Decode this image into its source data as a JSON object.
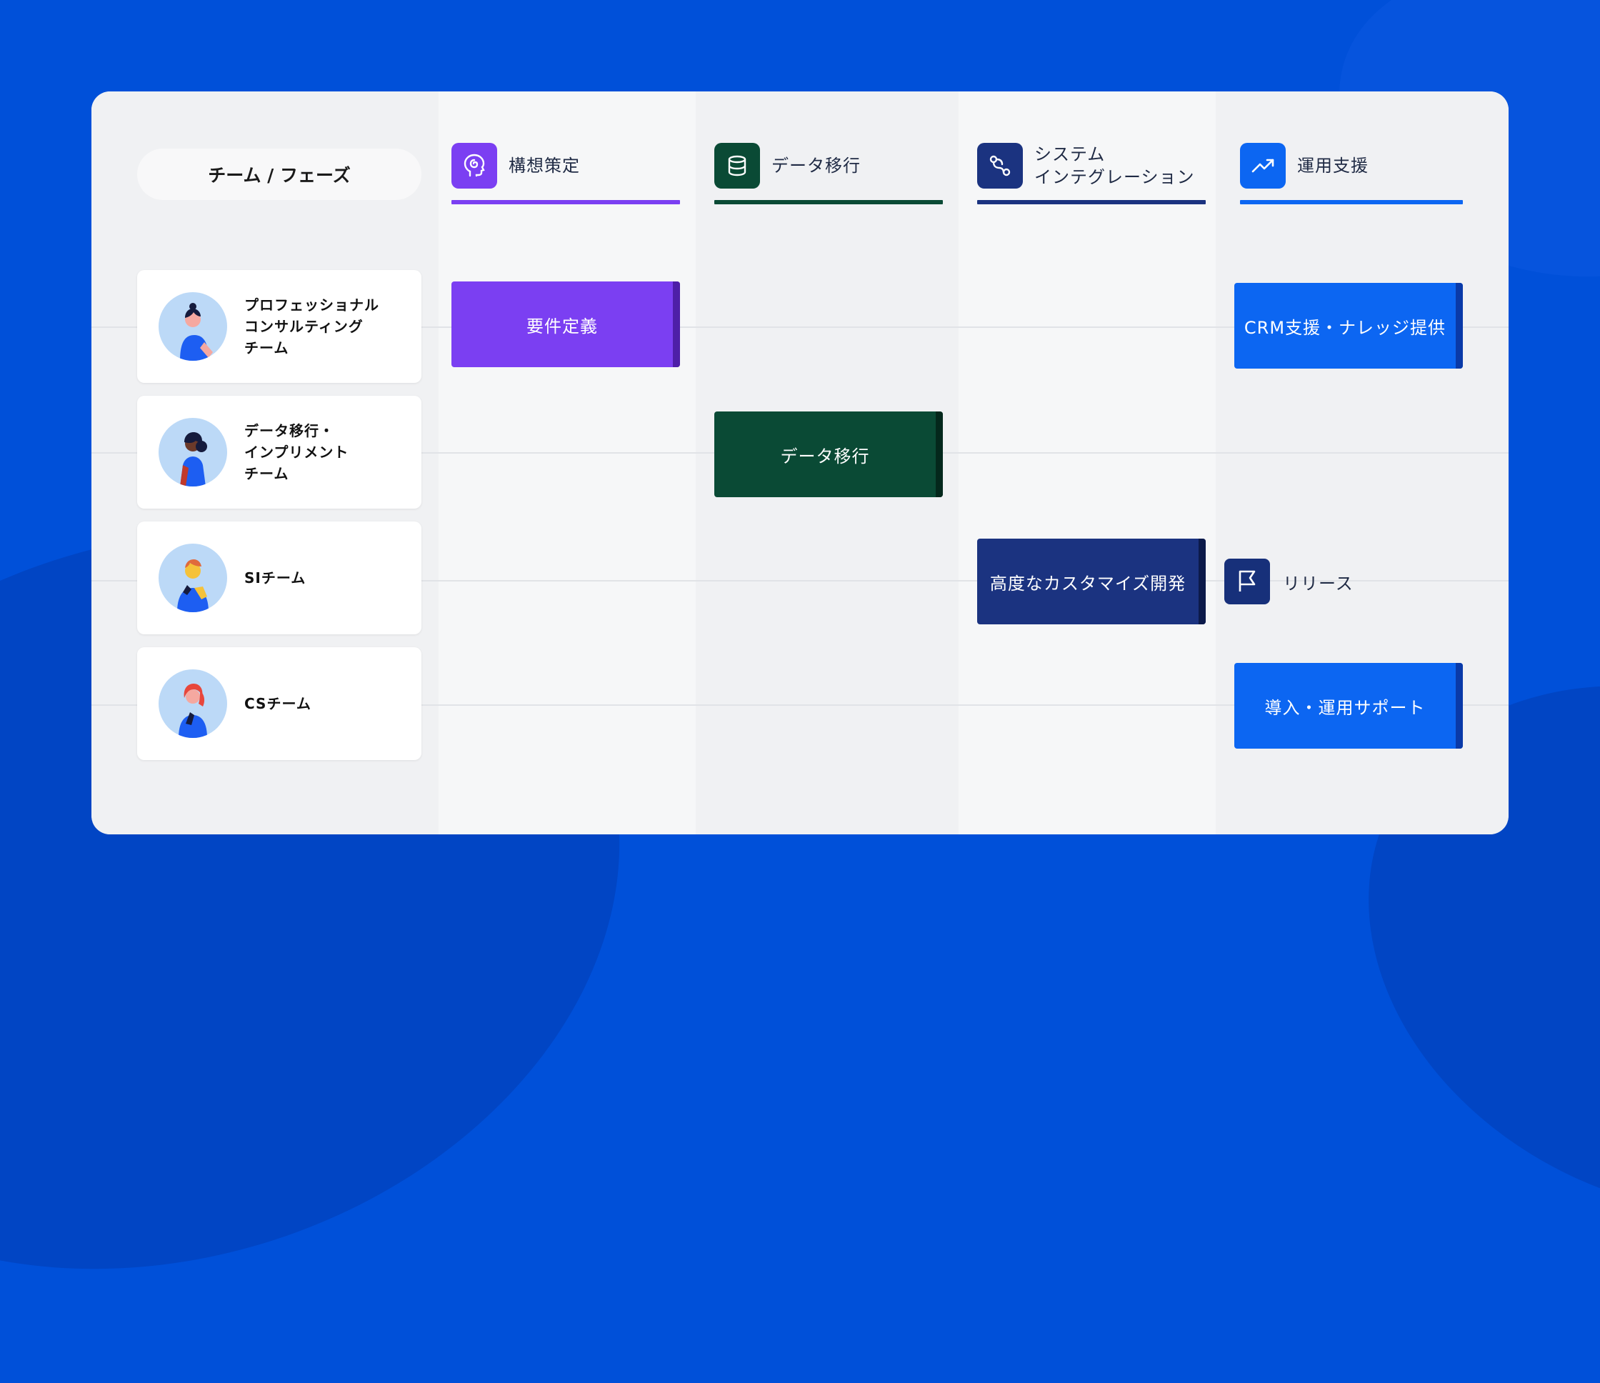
{
  "corner_label": "チーム / フェーズ",
  "phases": [
    {
      "title_lines": [
        "構想策定"
      ],
      "icon": "head-spiral-icon",
      "color": "#7b3ff2"
    },
    {
      "title_lines": [
        "データ移行"
      ],
      "icon": "database-icon",
      "color": "#0a4a35"
    },
    {
      "title_lines": [
        "システム",
        "インテグレーション"
      ],
      "icon": "integration-link-icon",
      "color": "#1b3380"
    },
    {
      "title_lines": [
        "運用支援"
      ],
      "icon": "trend-up-icon",
      "color": "#0c66f2"
    }
  ],
  "teams": [
    {
      "name_lines": [
        "プロフェッショナル",
        "コンサルティング",
        "チーム"
      ],
      "avatar": "consultant-avatar-icon"
    },
    {
      "name_lines": [
        "データ移行・",
        "インプリメント",
        "チーム"
      ],
      "avatar": "data-migration-avatar-icon"
    },
    {
      "name_lines": [
        "SIチーム"
      ],
      "avatar": "si-avatar-icon"
    },
    {
      "name_lines": [
        "CSチーム"
      ],
      "avatar": "cs-avatar-icon"
    }
  ],
  "tasks": [
    {
      "label": "要件定義",
      "color": "#7b3ff2",
      "edge": "#4e1fa8"
    },
    {
      "label": "CRM支援・ナレッジ提供",
      "color": "#0c66f2",
      "edge": "#0a3aa8"
    },
    {
      "label": "データ移行",
      "color": "#0a4a35",
      "edge": "#04281c"
    },
    {
      "label": "高度なカスタマイズ開発",
      "color": "#1b3380",
      "edge": "#0c1a4a"
    },
    {
      "label": "導入・運用サポート",
      "color": "#0c66f2",
      "edge": "#0a3aa8"
    }
  ],
  "milestone": {
    "label": "リリース",
    "icon": "flag-icon"
  }
}
